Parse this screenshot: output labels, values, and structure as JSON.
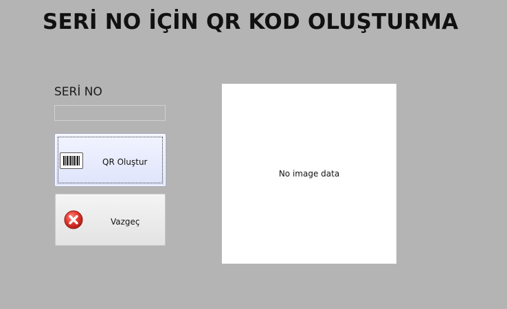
{
  "header": {
    "title": "SERİ NO İÇİN QR KOD OLUŞTURMA"
  },
  "form": {
    "serial_label": "SERİ NO",
    "serial_value": "",
    "serial_placeholder": ""
  },
  "buttons": {
    "generate_label": "QR Oluştur",
    "generate_icon": "barcode-icon",
    "cancel_label": "Vazgeç",
    "cancel_icon": "cancel-icon"
  },
  "image_preview": {
    "placeholder_text": "No image data"
  },
  "colors": {
    "background": "#b4b4b4",
    "cancel_red": "#d6302a",
    "preview_background": "#ffffff"
  }
}
